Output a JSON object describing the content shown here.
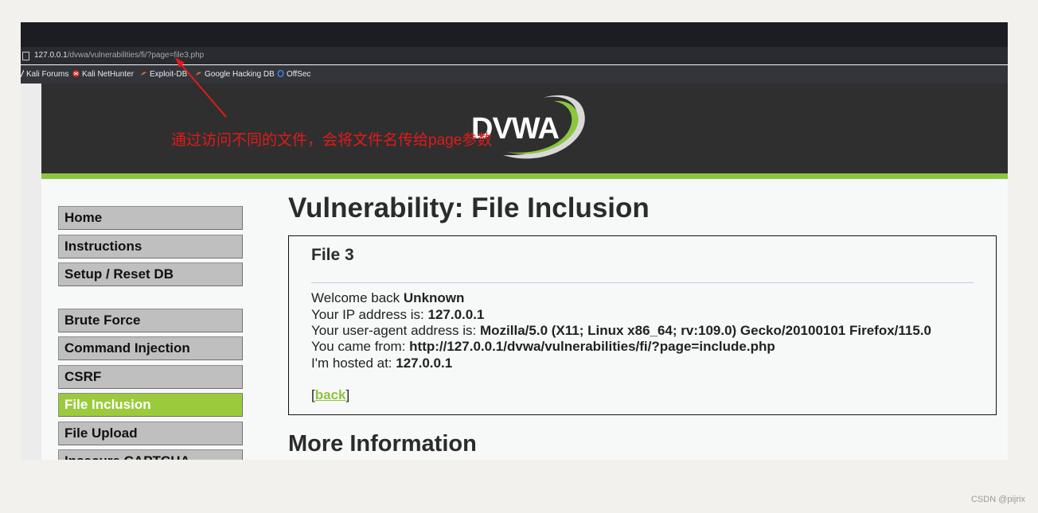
{
  "browser": {
    "url_host": "127.0.0.1",
    "url_path": "/dvwa/vulnerabilities/fi/?page=file3.php",
    "bookmarks": [
      {
        "label": "Kali Forums",
        "icon": "kali-forums-icon",
        "color": "#ffffff"
      },
      {
        "label": "Kali NetHunter",
        "icon": "kali-nethunter-icon",
        "color": "#e5322d"
      },
      {
        "label": "Exploit-DB",
        "icon": "exploit-db-icon",
        "color": "#e8742a"
      },
      {
        "label": "Google Hacking DB",
        "icon": "ghdb-icon",
        "color": "#e8742a"
      },
      {
        "label": "OffSec",
        "icon": "offsec-icon",
        "color": "#3f7ede"
      }
    ]
  },
  "header": {
    "logo_text": "DVWA"
  },
  "sidebar": {
    "items": [
      {
        "label": "Home"
      },
      {
        "label": "Instructions"
      },
      {
        "label": "Setup / Reset DB"
      },
      {
        "label": "Brute Force"
      },
      {
        "label": "Command Injection"
      },
      {
        "label": "CSRF"
      },
      {
        "label": "File Inclusion",
        "selected": true
      },
      {
        "label": "File Upload"
      },
      {
        "label": "Insecure CAPTCHA"
      }
    ]
  },
  "main": {
    "title": "Vulnerability: File Inclusion",
    "file": {
      "heading": "File 3",
      "welcome_prefix": "Welcome back ",
      "welcome_user": "Unknown",
      "ip_prefix": "Your IP address is: ",
      "ip": "127.0.0.1",
      "ua_prefix": "Your user-agent address is: ",
      "ua": "Mozilla/5.0 (X11; Linux x86_64; rv:109.0) Gecko/20100101 Firefox/115.0",
      "from_prefix": "You came from: ",
      "from": "http://127.0.0.1/dvwa/vulnerabilities/fi/?page=include.php",
      "host_prefix": "I'm hosted at: ",
      "host": "127.0.0.1",
      "back_open": "[",
      "back_label": "back",
      "back_close": "]"
    },
    "more_info": "More Information"
  },
  "annotation": {
    "text": "通过访问不同的文件，会将文件名传给page参数",
    "color": "#e21a1a"
  },
  "watermark": "CSDN @pijrix",
  "colors": {
    "accent": "#8cc63e",
    "header_bg": "#2f2f2f",
    "menu_bg": "#bfbfbf"
  }
}
